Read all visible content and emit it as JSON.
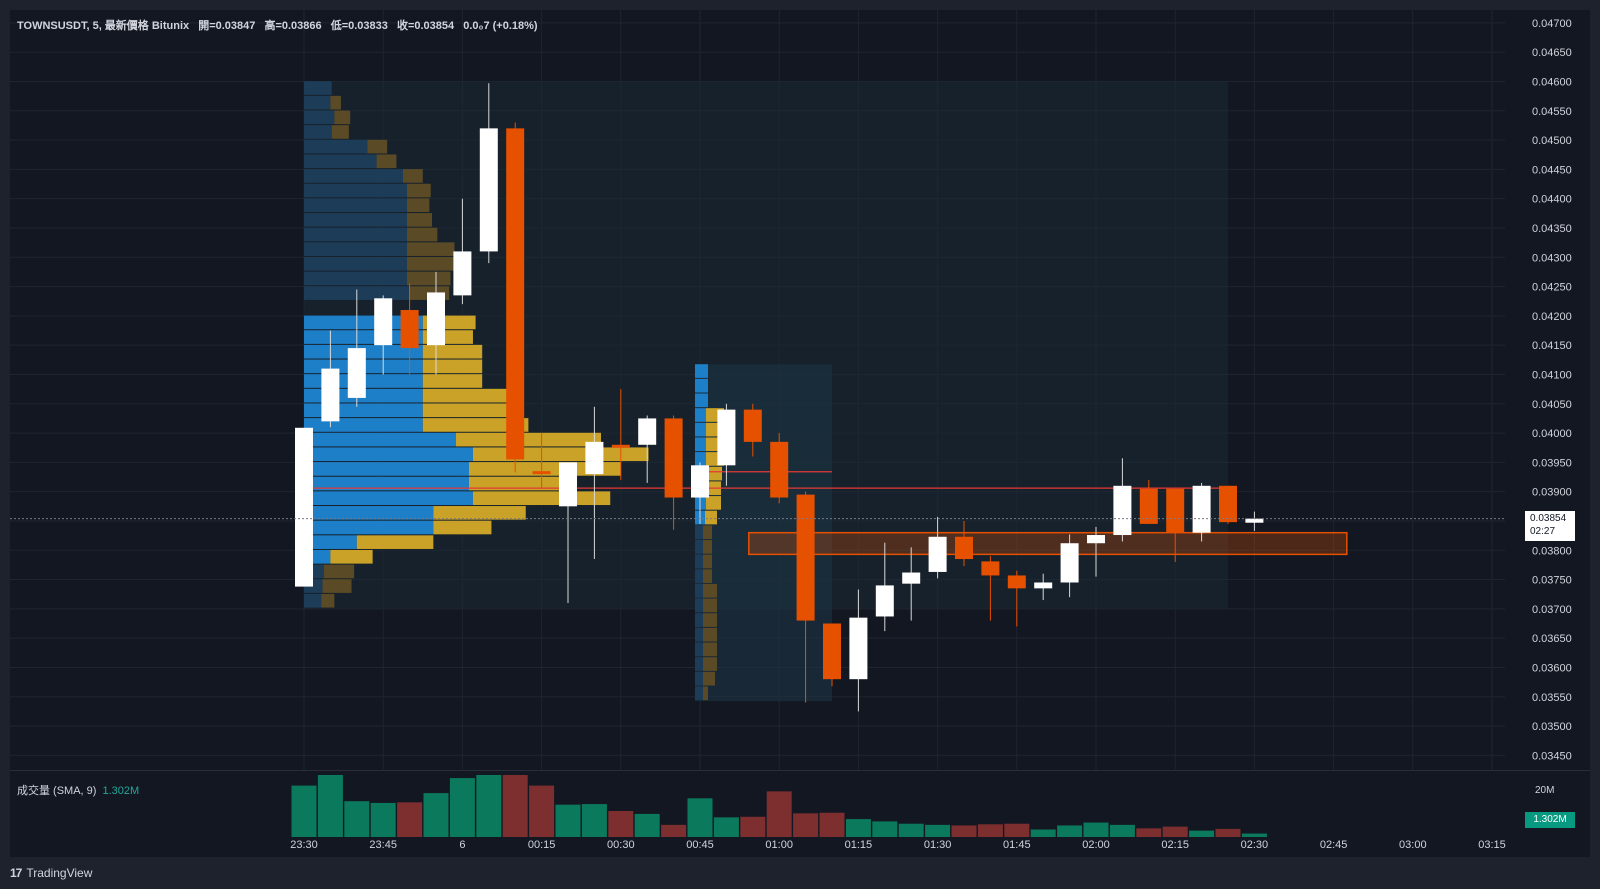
{
  "header": {
    "symbol": "TOWNSUSDT, 5, 最新價格 Bitunix",
    "open": "開=0.03847",
    "high": "高=0.03866",
    "low": "低=0.03833",
    "close": "收=0.03854",
    "change": "0.0₀7 (+0.18%)"
  },
  "volume_pane": {
    "label": "成交量 (SMA, 9)",
    "value": "1.302M",
    "axis_label": "20M",
    "badge": "1.302M"
  },
  "price_badge": {
    "price": "0.03854",
    "countdown": "02:27"
  },
  "brand": {
    "logo": "17",
    "name": "TradingView"
  },
  "colors": {
    "background": "#131722",
    "up": "#ffffff",
    "down": "#e65100",
    "profile_blue": "#1e88e5",
    "profile_gold": "#c9a227",
    "vol_up": "#0b7a5c",
    "vol_down": "#7d2e2e",
    "level_line": "#e53935"
  },
  "chart_data": {
    "type": "candlestick",
    "y_ticks": [
      "0.04700",
      "0.04650",
      "0.04600",
      "0.04550",
      "0.04500",
      "0.04450",
      "0.04400",
      "0.04350",
      "0.04300",
      "0.04250",
      "0.04200",
      "0.04150",
      "0.04100",
      "0.04050",
      "0.04000",
      "0.03950",
      "0.03900",
      "0.03850",
      "0.03800",
      "0.03750",
      "0.03700",
      "0.03650",
      "0.03600",
      "0.03550",
      "0.03500",
      "0.03450"
    ],
    "x_ticks": [
      "23:30",
      "23:45",
      "6",
      "00:15",
      "00:30",
      "00:45",
      "01:00",
      "01:15",
      "01:30",
      "01:45",
      "02:00",
      "02:15",
      "02:30",
      "02:45",
      "03:00",
      "03:15"
    ],
    "ylim": [
      0.03425,
      0.04722
    ],
    "candles": [
      {
        "t": 0,
        "o": 0.03738,
        "h": 0.04009,
        "l": 0.03738,
        "c": 0.04009
      },
      {
        "t": 1,
        "o": 0.0402,
        "h": 0.04175,
        "l": 0.0401,
        "c": 0.0411
      },
      {
        "t": 2,
        "o": 0.0406,
        "h": 0.04245,
        "l": 0.04045,
        "c": 0.04145
      },
      {
        "t": 3,
        "o": 0.0415,
        "h": 0.04235,
        "l": 0.041,
        "c": 0.0423
      },
      {
        "t": 4,
        "o": 0.0421,
        "h": 0.04255,
        "l": 0.041,
        "c": 0.04145
      },
      {
        "t": 5,
        "o": 0.0415,
        "h": 0.04275,
        "l": 0.041,
        "c": 0.0424
      },
      {
        "t": 6,
        "o": 0.04235,
        "h": 0.044,
        "l": 0.0422,
        "c": 0.0431
      },
      {
        "t": 7,
        "o": 0.0431,
        "h": 0.04597,
        "l": 0.0429,
        "c": 0.0452
      },
      {
        "t": 8,
        "o": 0.0452,
        "h": 0.0453,
        "l": 0.03933,
        "c": 0.03955
      },
      {
        "t": 9,
        "o": 0.03935,
        "h": 0.04,
        "l": 0.03905,
        "c": 0.0393
      },
      {
        "t": 10,
        "o": 0.03875,
        "h": 0.03945,
        "l": 0.0371,
        "c": 0.0395
      },
      {
        "t": 11,
        "o": 0.0393,
        "h": 0.04045,
        "l": 0.03785,
        "c": 0.03985
      },
      {
        "t": 12,
        "o": 0.0398,
        "h": 0.04075,
        "l": 0.0392,
        "c": 0.03975
      },
      {
        "t": 13,
        "o": 0.0398,
        "h": 0.0403,
        "l": 0.03915,
        "c": 0.04025
      },
      {
        "t": 14,
        "o": 0.04025,
        "h": 0.0403,
        "l": 0.03835,
        "c": 0.0389
      },
      {
        "t": 15,
        "o": 0.0389,
        "h": 0.0395,
        "l": 0.03845,
        "c": 0.03945
      },
      {
        "t": 16,
        "o": 0.03945,
        "h": 0.0405,
        "l": 0.0391,
        "c": 0.0404
      },
      {
        "t": 17,
        "o": 0.0404,
        "h": 0.0405,
        "l": 0.0396,
        "c": 0.03985
      },
      {
        "t": 18,
        "o": 0.03985,
        "h": 0.04,
        "l": 0.0388,
        "c": 0.0389
      },
      {
        "t": 19,
        "o": 0.03895,
        "h": 0.039,
        "l": 0.0354,
        "c": 0.0368
      },
      {
        "t": 20,
        "o": 0.03675,
        "h": 0.03675,
        "l": 0.03568,
        "c": 0.0358
      },
      {
        "t": 21,
        "o": 0.0358,
        "h": 0.03733,
        "l": 0.03525,
        "c": 0.03685
      },
      {
        "t": 22,
        "o": 0.03687,
        "h": 0.03813,
        "l": 0.03662,
        "c": 0.0374
      },
      {
        "t": 23,
        "o": 0.03743,
        "h": 0.03805,
        "l": 0.0368,
        "c": 0.03762
      },
      {
        "t": 24,
        "o": 0.03763,
        "h": 0.03857,
        "l": 0.03752,
        "c": 0.03823
      },
      {
        "t": 25,
        "o": 0.03823,
        "h": 0.0385,
        "l": 0.03773,
        "c": 0.03785
      },
      {
        "t": 26,
        "o": 0.03781,
        "h": 0.0379,
        "l": 0.0368,
        "c": 0.03757
      },
      {
        "t": 27,
        "o": 0.03757,
        "h": 0.03765,
        "l": 0.0367,
        "c": 0.03735
      },
      {
        "t": 28,
        "o": 0.03735,
        "h": 0.0376,
        "l": 0.03715,
        "c": 0.03745
      },
      {
        "t": 29,
        "o": 0.03745,
        "h": 0.03827,
        "l": 0.0372,
        "c": 0.03812
      },
      {
        "t": 30,
        "o": 0.03812,
        "h": 0.0384,
        "l": 0.03755,
        "c": 0.03826
      },
      {
        "t": 31,
        "o": 0.03826,
        "h": 0.03957,
        "l": 0.03815,
        "c": 0.0391
      },
      {
        "t": 32,
        "o": 0.03905,
        "h": 0.0392,
        "l": 0.03845,
        "c": 0.03845
      },
      {
        "t": 33,
        "o": 0.03905,
        "h": 0.03905,
        "l": 0.0378,
        "c": 0.0383
      },
      {
        "t": 34,
        "o": 0.0383,
        "h": 0.03915,
        "l": 0.03815,
        "c": 0.0391
      },
      {
        "t": 35,
        "o": 0.0391,
        "h": 0.0391,
        "l": 0.03845,
        "c": 0.03848
      },
      {
        "t": 36,
        "o": 0.03847,
        "h": 0.03866,
        "l": 0.03833,
        "c": 0.03854
      }
    ],
    "volume": [
      4.45,
      5.75,
      3.1,
      2.95,
      3.0,
      3.8,
      5.1,
      5.95,
      6.2,
      4.45,
      2.8,
      2.85,
      2.25,
      2.0,
      1.05,
      3.35,
      1.7,
      1.75,
      3.95,
      2.05,
      2.1,
      1.55,
      1.35,
      1.15,
      1.05,
      1.0,
      1.1,
      1.15,
      0.65,
      1.0,
      1.25,
      1.05,
      0.75,
      0.9,
      0.55,
      0.7,
      0.3
    ],
    "volume_ylim": [
      0,
      20
    ],
    "volume_profile_1": {
      "price_step": 0.00025,
      "rows": [
        {
          "p": 0.04588,
          "up": 2.1,
          "dn": 0.0
        },
        {
          "p": 0.04563,
          "up": 2.0,
          "dn": 0.8
        },
        {
          "p": 0.04538,
          "up": 2.3,
          "dn": 1.2
        },
        {
          "p": 0.04513,
          "up": 2.1,
          "dn": 1.3
        },
        {
          "p": 0.04488,
          "up": 4.8,
          "dn": 1.5
        },
        {
          "p": 0.04463,
          "up": 5.5,
          "dn": 1.5
        },
        {
          "p": 0.04438,
          "up": 7.5,
          "dn": 1.5
        },
        {
          "p": 0.04413,
          "up": 7.8,
          "dn": 1.8
        },
        {
          "p": 0.04388,
          "up": 7.8,
          "dn": 1.7
        },
        {
          "p": 0.04363,
          "up": 7.8,
          "dn": 1.9
        },
        {
          "p": 0.04338,
          "up": 7.8,
          "dn": 2.3
        },
        {
          "p": 0.04313,
          "up": 7.8,
          "dn": 3.6
        },
        {
          "p": 0.04288,
          "up": 7.8,
          "dn": 3.7
        },
        {
          "p": 0.04263,
          "up": 7.8,
          "dn": 3.3
        },
        {
          "p": 0.04238,
          "up": 8.0,
          "dn": 3.0
        },
        {
          "p": 0.04188,
          "up": 9.0,
          "dn": 4.0
        },
        {
          "p": 0.04163,
          "up": 9.0,
          "dn": 3.8
        },
        {
          "p": 0.04138,
          "up": 9.0,
          "dn": 4.5
        },
        {
          "p": 0.04113,
          "up": 9.0,
          "dn": 4.5
        },
        {
          "p": 0.04088,
          "up": 9.0,
          "dn": 4.5
        },
        {
          "p": 0.04063,
          "up": 9.0,
          "dn": 6.5
        },
        {
          "p": 0.04038,
          "up": 9.0,
          "dn": 7.5
        },
        {
          "p": 0.04013,
          "up": 9.0,
          "dn": 8.0
        },
        {
          "p": 0.03988,
          "up": 11.5,
          "dn": 11.0
        },
        {
          "p": 0.03963,
          "up": 12.8,
          "dn": 13.3
        },
        {
          "p": 0.03938,
          "up": 12.5,
          "dn": 11.5
        },
        {
          "p": 0.03913,
          "up": 12.5,
          "dn": 8.0
        },
        {
          "p": 0.03888,
          "up": 12.8,
          "dn": 10.4
        },
        {
          "p": 0.03863,
          "up": 9.8,
          "dn": 7.0
        },
        {
          "p": 0.03838,
          "up": 9.8,
          "dn": 4.4
        },
        {
          "p": 0.03813,
          "up": 4.0,
          "dn": 5.8
        },
        {
          "p": 0.03788,
          "up": 2.0,
          "dn": 3.2
        },
        {
          "p": 0.03763,
          "up": 1.5,
          "dn": 2.3
        },
        {
          "p": 0.03738,
          "up": 1.4,
          "dn": 2.2
        },
        {
          "p": 0.03713,
          "up": 1.3,
          "dn": 1.0
        }
      ]
    },
    "volume_profile_2": {
      "price_step": 0.00025,
      "rows": [
        {
          "p": 0.04105,
          "up": 1.3,
          "dn": 0.0
        },
        {
          "p": 0.0408,
          "up": 1.3,
          "dn": 0.0
        },
        {
          "p": 0.04055,
          "up": 1.3,
          "dn": 0.0
        },
        {
          "p": 0.0403,
          "up": 1.1,
          "dn": 1.8
        },
        {
          "p": 0.04005,
          "up": 1.1,
          "dn": 1.8
        },
        {
          "p": 0.0398,
          "up": 1.1,
          "dn": 1.8
        },
        {
          "p": 0.03955,
          "up": 1.1,
          "dn": 1.8
        },
        {
          "p": 0.0393,
          "up": 1.1,
          "dn": 1.6
        },
        {
          "p": 0.03905,
          "up": 1.1,
          "dn": 1.5
        },
        {
          "p": 0.0388,
          "up": 1.1,
          "dn": 1.5
        },
        {
          "p": 0.03855,
          "up": 1.0,
          "dn": 1.2
        },
        {
          "p": 0.0383,
          "up": 0.8,
          "dn": 0.9
        },
        {
          "p": 0.03805,
          "up": 0.8,
          "dn": 0.9
        },
        {
          "p": 0.0378,
          "up": 0.8,
          "dn": 0.9
        },
        {
          "p": 0.03755,
          "up": 0.8,
          "dn": 0.9
        },
        {
          "p": 0.0373,
          "up": 0.8,
          "dn": 1.4
        },
        {
          "p": 0.03705,
          "up": 0.8,
          "dn": 1.4
        },
        {
          "p": 0.0368,
          "up": 0.8,
          "dn": 1.4
        },
        {
          "p": 0.03655,
          "up": 0.8,
          "dn": 1.4
        },
        {
          "p": 0.0363,
          "up": 0.8,
          "dn": 1.4
        },
        {
          "p": 0.03605,
          "up": 0.8,
          "dn": 1.4
        },
        {
          "p": 0.0358,
          "up": 0.8,
          "dn": 1.2
        },
        {
          "p": 0.03555,
          "up": 0.8,
          "dn": 0.5
        }
      ]
    },
    "levels": [
      0.03934,
      0.03906
    ],
    "zone": [
      0.03793,
      0.0383
    ],
    "last_price": 0.03854
  }
}
